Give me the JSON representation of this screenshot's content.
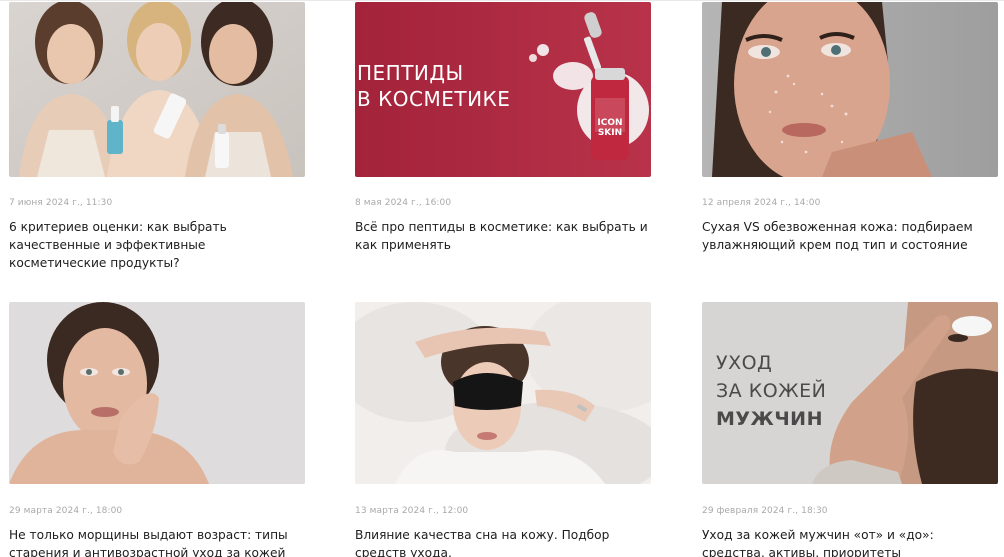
{
  "articles": [
    {
      "date": "7 июня 2024 г., 11:30",
      "title": "6 критериев оценки: как выбрать качественные и эффективные косметические продукты?"
    },
    {
      "date": "8 мая 2024 г., 16:00",
      "title": "Всё про пептиды в косметике: как выбрать и как применять",
      "image_text": [
        "ПЕПТИДЫ",
        "В КОСМЕТИКЕ"
      ],
      "bottle_label": [
        "ICON",
        "SKIN"
      ]
    },
    {
      "date": "12 апреля 2024 г., 14:00",
      "title": "Сухая VS обезвоженная кожа: подбираем увлажняющий крем под тип и состояние"
    },
    {
      "date": "29 марта 2024 г., 18:00",
      "title": "Не только морщины выдают возраст: типы старения и антивозрастной уход за кожей"
    },
    {
      "date": "13 марта 2024 г., 12:00",
      "title": "Влияние качества сна на кожу. Подбор средств ухода."
    },
    {
      "date": "29 февраля 2024 г., 18:30",
      "title": "Уход за кожей мужчин «от» и «до»: средства, активы, приоритеты",
      "image_text": [
        "УХОД",
        "ЗА КОЖЕЙ",
        "МУЖЧИН"
      ]
    }
  ],
  "colors": {
    "date": "#a9a9a9",
    "title": "#1d1d1d",
    "peptide_bg": "#a8283a"
  }
}
